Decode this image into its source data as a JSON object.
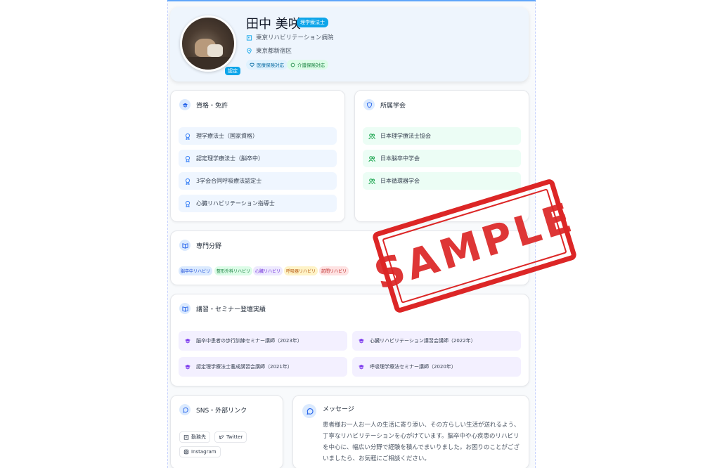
{
  "profile": {
    "name": "田中 美咲",
    "role_badge": "理学療法士",
    "verified_label": "認定",
    "hospital": "東京リハビリテーション病院",
    "location": "東京都新宿区",
    "insurance": [
      "医療保険対応",
      "介護保険対応"
    ]
  },
  "qualifications": {
    "title": "資格・免許",
    "items": [
      "理学療法士（国家資格）",
      "認定理学療法士（脳卒中）",
      "3学会合同呼吸療法認定士",
      "心臓リハビリテーション指導士"
    ]
  },
  "societies": {
    "title": "所属学会",
    "items": [
      "日本理学療法士協会",
      "日本脳卒中学会",
      "日本循環器学会"
    ]
  },
  "specialties": {
    "title": "専門分野",
    "tags": [
      "脳卒中リハビリ",
      "整形外科リハビリ",
      "心臓リハビリ",
      "呼吸器リハビリ",
      "訪問リハビリ"
    ]
  },
  "seminars": {
    "title": "講習・セミナー登壇実績",
    "items": [
      "脳卒中患者の歩行訓練セミナー講師（2023年）",
      "心臓リハビリテーション講習会講師（2022年）",
      "認定理学療法士養成講習会講師（2021年）",
      "呼吸理学療法セミナー講師（2020年）"
    ]
  },
  "sns": {
    "title": "SNS・外部リンク",
    "links": [
      "勤務先",
      "Twitter",
      "Instagram"
    ]
  },
  "message": {
    "title": "メッセージ",
    "body": "患者様お一人お一人の生活に寄り添い、その方らしい生活が送れるよう、丁寧なリハビリテーションを心がけています。脳卒中や心疾患のリハビリを中心に、幅広い分野で経験を積んでまいりました。お困りのことがございましたら、お気軽にご相談ください。"
  },
  "stamp": "SAMPLE",
  "colors": {
    "accent": "#0ea5e9",
    "stamp": "#dc2626"
  }
}
